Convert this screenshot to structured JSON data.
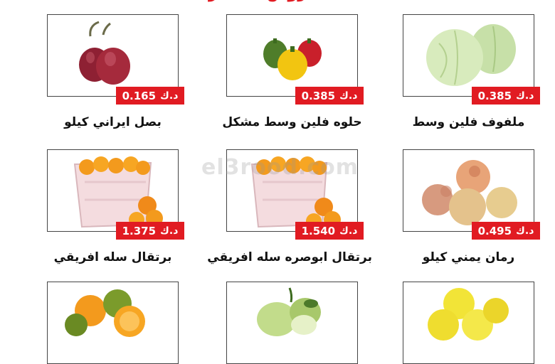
{
  "banner": {
    "text": "عروض الخضار"
  },
  "watermark": "el3rood.com",
  "currency": "د.ك",
  "products": [
    {
      "id": "onion",
      "name": "بصل ايراني كيلو",
      "price": "0.165",
      "icon": "red-onion-icon"
    },
    {
      "id": "pepper",
      "name": "حلوه فلين وسط مشكل",
      "price": "0.385",
      "icon": "bell-peppers-icon"
    },
    {
      "id": "cabbage",
      "name": "ملفوف فلين وسط",
      "price": "0.385",
      "icon": "cabbage-icon"
    },
    {
      "id": "orange-africa",
      "name": "برتقال سله افريقي",
      "price": "1.375",
      "icon": "orange-crate-icon"
    },
    {
      "id": "orange-navel",
      "name": "برتقال ابوصره سله افريقي",
      "price": "1.540",
      "icon": "orange-crate-icon"
    },
    {
      "id": "pomegranate",
      "name": "رمان يمني كيلو",
      "price": "0.495",
      "icon": "pomegranate-icon"
    },
    {
      "id": "citrus",
      "name": "",
      "price": "",
      "icon": "citrus-mix-icon"
    },
    {
      "id": "guava",
      "name": "",
      "price": "",
      "icon": "guava-icon"
    },
    {
      "id": "apple",
      "name": "",
      "price": "",
      "icon": "yellow-apple-icon"
    }
  ],
  "colors": {
    "accent": "#e11b22",
    "text": "#111111",
    "border": "#444444"
  }
}
